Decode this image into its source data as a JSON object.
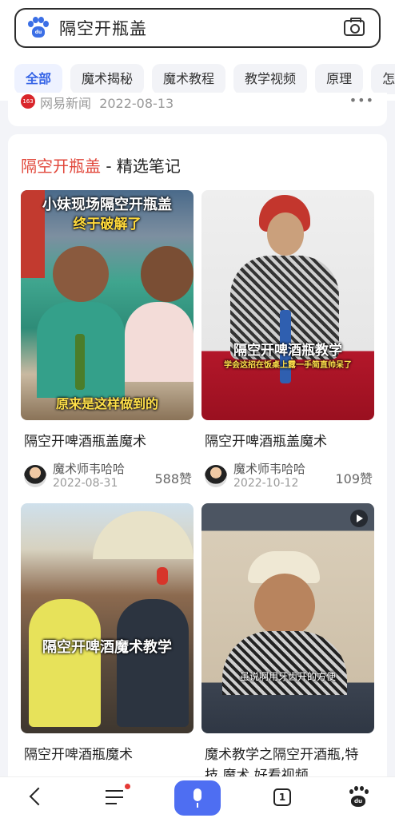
{
  "search": {
    "query": "隔空开瓶盖",
    "logo_text": "du"
  },
  "tabs": [
    "全部",
    "魔术揭秘",
    "魔术教程",
    "教学视频",
    "原理",
    "怎"
  ],
  "prev_card": {
    "source": "网易新闻",
    "date": "2022-08-13",
    "more": "•••",
    "icon_text": "163"
  },
  "notes_card": {
    "title_highlight": "隔空开瓶盖",
    "title_rest": " - 精选笔记",
    "notes": [
      {
        "title": "隔空开啤酒瓶盖魔术",
        "author": "魔术师韦哈哈",
        "date": "2022-08-31",
        "likes": "588赞",
        "overlay_top": "小妹现场隔空开瓶盖",
        "overlay_sub": "终于破解了",
        "overlay_bottom": "原来是这样做到的"
      },
      {
        "title": "隔空开啤酒瓶盖魔术",
        "author": "魔术师韦哈哈",
        "date": "2022-10-12",
        "likes": "109赞",
        "overlay_main": "隔空开啤酒瓶教学",
        "overlay_sub": "学会这招在饭桌上露一手简直帅呆了"
      },
      {
        "title": "隔空开啤酒瓶魔术",
        "overlay_main": "隔空开啤酒魔术教学"
      },
      {
        "title": "魔术教学之隔空开酒瓶,特技,魔术,好看视频",
        "overlay_sub": "虽说啊用牙齿开的方便"
      }
    ]
  },
  "bottom_nav": {
    "tab_badge": "1",
    "logo_text": "du"
  },
  "colors": {
    "accent": "#4e6ef2",
    "highlight": "#e1463a",
    "tab_active": "#3564e6"
  }
}
